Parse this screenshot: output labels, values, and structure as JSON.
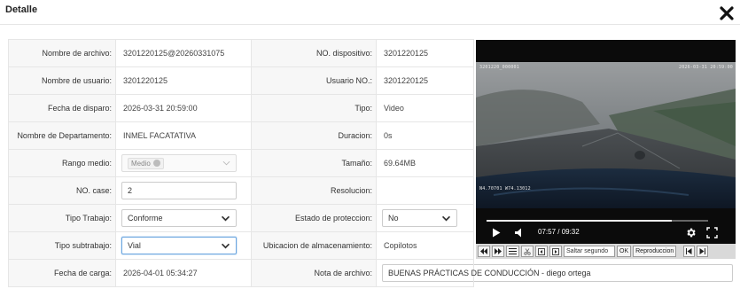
{
  "modal": {
    "title": "Detalle"
  },
  "fields": {
    "nombre_archivo": {
      "label": "Nombre de archivo:",
      "value": "3201220125@20260331075"
    },
    "no_dispositivo": {
      "label": "NO. dispositivo:",
      "value": "3201220125"
    },
    "nombre_usuario": {
      "label": "Nombre de usuario:",
      "value": "3201220125"
    },
    "usuario_no": {
      "label": "Usuario NO.:",
      "value": "3201220125"
    },
    "fecha_disparo": {
      "label": "Fecha de disparo:",
      "value": "2026-03-31 20:59:00"
    },
    "tipo": {
      "label": "Tipo:",
      "value": "Video"
    },
    "departamento": {
      "label": "Nombre de Departamento:",
      "value": "INMEL FACATATIVA"
    },
    "duracion": {
      "label": "Duracion:",
      "value": "0s"
    },
    "rango_medio": {
      "label": "Rango medio:",
      "tag": "Medio"
    },
    "tamano": {
      "label": "Tamaño:",
      "value": "69.64MB"
    },
    "no_case": {
      "label": "NO. case:",
      "value": "2"
    },
    "resolucion": {
      "label": "Resolucion:",
      "value": ""
    },
    "tipo_trabajo": {
      "label": "Tipo Trabajo:",
      "value": "Conforme"
    },
    "estado_proteccion": {
      "label": "Estado de proteccion:",
      "value": "No"
    },
    "tipo_subtrabajo": {
      "label": "Tipo subtrabajo:",
      "value": "Vial"
    },
    "ubicacion": {
      "label": "Ubicacion de almacenamiento:",
      "value": "Copilotos"
    },
    "fecha_carga": {
      "label": "Fecha de carga:",
      "value": "2026-04-01 05:34:27"
    },
    "nota_archivo": {
      "label": "Nota de archivo:",
      "value": "BUENAS PRÁCTICAS DE CONDUCCIÓN - diego ortega"
    }
  },
  "player": {
    "overlay_left": "3201220_000001",
    "overlay_right": "2026-03-31 20:59:00",
    "overlay_bottom": "N4.70701 W74.13012",
    "time": "07:57 / 09:32",
    "progress": 0.834,
    "icons": [
      "play-icon",
      "volume-icon",
      "gear-icon",
      "fullscreen-icon"
    ]
  },
  "toolbar": {
    "buttons": [
      "rewind-icon",
      "fast-forward-icon",
      "list-icon",
      "scissors-icon",
      "frame-back-icon",
      "frame-forward-icon"
    ],
    "seek_placeholder": "Saltar segundo",
    "ok_label": "OK",
    "repro_label": "Reproduccion",
    "end_buttons": [
      "skip-start-icon",
      "skip-end-icon"
    ]
  },
  "colors": {
    "label_bg": "#f7f7f7",
    "border": "#e6e6e6",
    "focus_border": "#6da7e0",
    "player_bg": "#0b0b0b",
    "toolbar_bg": "#d9d9d9"
  }
}
